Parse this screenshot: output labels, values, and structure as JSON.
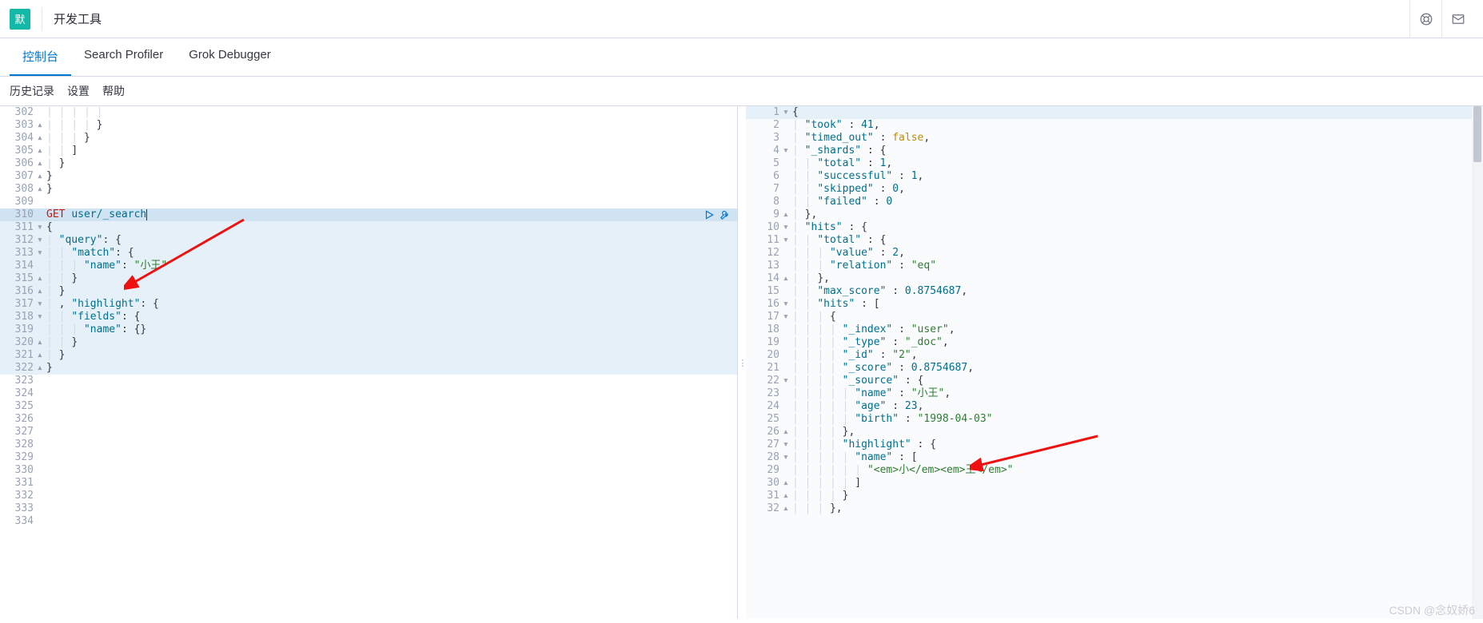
{
  "header": {
    "badge": "默",
    "title": "开发工具"
  },
  "tabs": {
    "items": [
      {
        "label": "控制台",
        "active": true
      },
      {
        "label": "Search Profiler",
        "active": false
      },
      {
        "label": "Grok Debugger",
        "active": false
      }
    ]
  },
  "subtabs": {
    "history": "历史记录",
    "settings": "设置",
    "help": "帮助"
  },
  "request": {
    "active_line": 310,
    "method": "GET",
    "path": "user/_search",
    "lines": [
      {
        "n": 302,
        "fold": "",
        "indent": 5,
        "tokens": []
      },
      {
        "n": 303,
        "fold": "▴",
        "indent": 4,
        "tokens": [
          {
            "t": "punc",
            "v": "}"
          }
        ]
      },
      {
        "n": 304,
        "fold": "▴",
        "indent": 3,
        "tokens": [
          {
            "t": "punc",
            "v": "}"
          }
        ]
      },
      {
        "n": 305,
        "fold": "▴",
        "indent": 2,
        "tokens": [
          {
            "t": "punc",
            "v": "]"
          }
        ]
      },
      {
        "n": 306,
        "fold": "▴",
        "indent": 1,
        "tokens": [
          {
            "t": "punc",
            "v": "}"
          }
        ]
      },
      {
        "n": 307,
        "fold": "▴",
        "indent": 0,
        "tokens": [
          {
            "t": "punc",
            "v": "}"
          }
        ]
      },
      {
        "n": 308,
        "fold": "▴",
        "indent": 0,
        "tokens": [
          {
            "t": "punc",
            "v": "}"
          }
        ],
        "outdent": true
      },
      {
        "n": 309,
        "fold": "",
        "indent": 0,
        "tokens": []
      },
      {
        "n": 310,
        "fold": "",
        "indent": 0,
        "active": true,
        "request_line": true
      },
      {
        "n": 311,
        "fold": "▾",
        "indent": 0,
        "hl": true,
        "tokens": [
          {
            "t": "punc",
            "v": "{"
          }
        ],
        "outdent": true
      },
      {
        "n": 312,
        "fold": "▾",
        "indent": 1,
        "hl": true,
        "tokens": [
          {
            "t": "key",
            "v": "\"query\""
          },
          {
            "t": "punc",
            "v": ": {"
          }
        ]
      },
      {
        "n": 313,
        "fold": "▾",
        "indent": 2,
        "hl": true,
        "tokens": [
          {
            "t": "key",
            "v": "\"match\""
          },
          {
            "t": "punc",
            "v": ": {"
          }
        ]
      },
      {
        "n": 314,
        "fold": "",
        "indent": 3,
        "hl": true,
        "tokens": [
          {
            "t": "key",
            "v": "\"name\""
          },
          {
            "t": "punc",
            "v": ": "
          },
          {
            "t": "str",
            "v": "\"小王\""
          }
        ]
      },
      {
        "n": 315,
        "fold": "▴",
        "indent": 2,
        "hl": true,
        "tokens": [
          {
            "t": "punc",
            "v": "}"
          }
        ]
      },
      {
        "n": 316,
        "fold": "▴",
        "indent": 1,
        "hl": true,
        "tokens": [
          {
            "t": "punc",
            "v": "}"
          }
        ]
      },
      {
        "n": 317,
        "fold": "▾",
        "indent": 1,
        "hl": true,
        "tokens": [
          {
            "t": "punc",
            "v": ", "
          },
          {
            "t": "key",
            "v": "\"highlight\""
          },
          {
            "t": "punc",
            "v": ": {"
          }
        ]
      },
      {
        "n": 318,
        "fold": "▾",
        "indent": 2,
        "hl": true,
        "tokens": [
          {
            "t": "key",
            "v": "\"fields\""
          },
          {
            "t": "punc",
            "v": ": {"
          }
        ]
      },
      {
        "n": 319,
        "fold": "",
        "indent": 3,
        "hl": true,
        "tokens": [
          {
            "t": "key",
            "v": "\"name\""
          },
          {
            "t": "punc",
            "v": ": {}"
          }
        ]
      },
      {
        "n": 320,
        "fold": "▴",
        "indent": 2,
        "hl": true,
        "tokens": [
          {
            "t": "punc",
            "v": "}"
          }
        ]
      },
      {
        "n": 321,
        "fold": "▴",
        "indent": 1,
        "hl": true,
        "tokens": [
          {
            "t": "punc",
            "v": "}"
          }
        ]
      },
      {
        "n": 322,
        "fold": "▴",
        "indent": 0,
        "hl": true,
        "tokens": [
          {
            "t": "punc",
            "v": "}"
          }
        ],
        "outdent": true
      },
      {
        "n": 323,
        "fold": "",
        "indent": 0,
        "tokens": []
      },
      {
        "n": 324,
        "fold": "",
        "indent": 0,
        "tokens": []
      },
      {
        "n": 325,
        "fold": "",
        "indent": 0,
        "tokens": []
      },
      {
        "n": 326,
        "fold": "",
        "indent": 0,
        "tokens": []
      },
      {
        "n": 327,
        "fold": "",
        "indent": 0,
        "tokens": []
      },
      {
        "n": 328,
        "fold": "",
        "indent": 0,
        "tokens": []
      },
      {
        "n": 329,
        "fold": "",
        "indent": 0,
        "tokens": []
      },
      {
        "n": 330,
        "fold": "",
        "indent": 0,
        "tokens": []
      },
      {
        "n": 331,
        "fold": "",
        "indent": 0,
        "tokens": []
      },
      {
        "n": 332,
        "fold": "",
        "indent": 0,
        "tokens": []
      },
      {
        "n": 333,
        "fold": "",
        "indent": 0,
        "tokens": []
      },
      {
        "n": 334,
        "fold": "",
        "indent": 0,
        "tokens": []
      }
    ]
  },
  "response": {
    "lines": [
      {
        "n": 1,
        "fold": "▾",
        "indent": 0,
        "first": true,
        "tokens": [
          {
            "t": "punc",
            "v": "{"
          }
        ],
        "outdent": true
      },
      {
        "n": 2,
        "fold": "",
        "indent": 1,
        "tokens": [
          {
            "t": "key",
            "v": "\"took\""
          },
          {
            "t": "punc",
            "v": " : "
          },
          {
            "t": "num",
            "v": "41"
          },
          {
            "t": "punc",
            "v": ","
          }
        ]
      },
      {
        "n": 3,
        "fold": "",
        "indent": 1,
        "tokens": [
          {
            "t": "key",
            "v": "\"timed_out\""
          },
          {
            "t": "punc",
            "v": " : "
          },
          {
            "t": "bool",
            "v": "false"
          },
          {
            "t": "punc",
            "v": ","
          }
        ]
      },
      {
        "n": 4,
        "fold": "▾",
        "indent": 1,
        "tokens": [
          {
            "t": "key",
            "v": "\"_shards\""
          },
          {
            "t": "punc",
            "v": " : {"
          }
        ]
      },
      {
        "n": 5,
        "fold": "",
        "indent": 2,
        "tokens": [
          {
            "t": "key",
            "v": "\"total\""
          },
          {
            "t": "punc",
            "v": " : "
          },
          {
            "t": "num",
            "v": "1"
          },
          {
            "t": "punc",
            "v": ","
          }
        ]
      },
      {
        "n": 6,
        "fold": "",
        "indent": 2,
        "tokens": [
          {
            "t": "key",
            "v": "\"successful\""
          },
          {
            "t": "punc",
            "v": " : "
          },
          {
            "t": "num",
            "v": "1"
          },
          {
            "t": "punc",
            "v": ","
          }
        ]
      },
      {
        "n": 7,
        "fold": "",
        "indent": 2,
        "tokens": [
          {
            "t": "key",
            "v": "\"skipped\""
          },
          {
            "t": "punc",
            "v": " : "
          },
          {
            "t": "num",
            "v": "0"
          },
          {
            "t": "punc",
            "v": ","
          }
        ]
      },
      {
        "n": 8,
        "fold": "",
        "indent": 2,
        "tokens": [
          {
            "t": "key",
            "v": "\"failed\""
          },
          {
            "t": "punc",
            "v": " : "
          },
          {
            "t": "num",
            "v": "0"
          }
        ]
      },
      {
        "n": 9,
        "fold": "▴",
        "indent": 1,
        "tokens": [
          {
            "t": "punc",
            "v": "},"
          }
        ]
      },
      {
        "n": 10,
        "fold": "▾",
        "indent": 1,
        "tokens": [
          {
            "t": "key",
            "v": "\"hits\""
          },
          {
            "t": "punc",
            "v": " : {"
          }
        ]
      },
      {
        "n": 11,
        "fold": "▾",
        "indent": 2,
        "tokens": [
          {
            "t": "key",
            "v": "\"total\""
          },
          {
            "t": "punc",
            "v": " : {"
          }
        ]
      },
      {
        "n": 12,
        "fold": "",
        "indent": 3,
        "tokens": [
          {
            "t": "key",
            "v": "\"value\""
          },
          {
            "t": "punc",
            "v": " : "
          },
          {
            "t": "num",
            "v": "2"
          },
          {
            "t": "punc",
            "v": ","
          }
        ]
      },
      {
        "n": 13,
        "fold": "",
        "indent": 3,
        "tokens": [
          {
            "t": "key",
            "v": "\"relation\""
          },
          {
            "t": "punc",
            "v": " : "
          },
          {
            "t": "str",
            "v": "\"eq\""
          }
        ]
      },
      {
        "n": 14,
        "fold": "▴",
        "indent": 2,
        "tokens": [
          {
            "t": "punc",
            "v": "},"
          }
        ]
      },
      {
        "n": 15,
        "fold": "",
        "indent": 2,
        "tokens": [
          {
            "t": "key",
            "v": "\"max_score\""
          },
          {
            "t": "punc",
            "v": " : "
          },
          {
            "t": "num",
            "v": "0.8754687"
          },
          {
            "t": "punc",
            "v": ","
          }
        ]
      },
      {
        "n": 16,
        "fold": "▾",
        "indent": 2,
        "tokens": [
          {
            "t": "key",
            "v": "\"hits\""
          },
          {
            "t": "punc",
            "v": " : ["
          }
        ]
      },
      {
        "n": 17,
        "fold": "▾",
        "indent": 3,
        "tokens": [
          {
            "t": "punc",
            "v": "{"
          }
        ]
      },
      {
        "n": 18,
        "fold": "",
        "indent": 4,
        "tokens": [
          {
            "t": "key",
            "v": "\"_index\""
          },
          {
            "t": "punc",
            "v": " : "
          },
          {
            "t": "str",
            "v": "\"user\""
          },
          {
            "t": "punc",
            "v": ","
          }
        ]
      },
      {
        "n": 19,
        "fold": "",
        "indent": 4,
        "tokens": [
          {
            "t": "key",
            "v": "\"_type\""
          },
          {
            "t": "punc",
            "v": " : "
          },
          {
            "t": "str",
            "v": "\"_doc\""
          },
          {
            "t": "punc",
            "v": ","
          }
        ]
      },
      {
        "n": 20,
        "fold": "",
        "indent": 4,
        "tokens": [
          {
            "t": "key",
            "v": "\"_id\""
          },
          {
            "t": "punc",
            "v": " : "
          },
          {
            "t": "str",
            "v": "\"2\""
          },
          {
            "t": "punc",
            "v": ","
          }
        ]
      },
      {
        "n": 21,
        "fold": "",
        "indent": 4,
        "tokens": [
          {
            "t": "key",
            "v": "\"_score\""
          },
          {
            "t": "punc",
            "v": " : "
          },
          {
            "t": "num",
            "v": "0.8754687"
          },
          {
            "t": "punc",
            "v": ","
          }
        ]
      },
      {
        "n": 22,
        "fold": "▾",
        "indent": 4,
        "tokens": [
          {
            "t": "key",
            "v": "\"_source\""
          },
          {
            "t": "punc",
            "v": " : {"
          }
        ]
      },
      {
        "n": 23,
        "fold": "",
        "indent": 5,
        "tokens": [
          {
            "t": "key",
            "v": "\"name\""
          },
          {
            "t": "punc",
            "v": " : "
          },
          {
            "t": "str",
            "v": "\"小王\""
          },
          {
            "t": "punc",
            "v": ","
          }
        ]
      },
      {
        "n": 24,
        "fold": "",
        "indent": 5,
        "tokens": [
          {
            "t": "key",
            "v": "\"age\""
          },
          {
            "t": "punc",
            "v": " : "
          },
          {
            "t": "num",
            "v": "23"
          },
          {
            "t": "punc",
            "v": ","
          }
        ]
      },
      {
        "n": 25,
        "fold": "",
        "indent": 5,
        "tokens": [
          {
            "t": "key",
            "v": "\"birth\""
          },
          {
            "t": "punc",
            "v": " : "
          },
          {
            "t": "str",
            "v": "\"1998-04-03\""
          }
        ]
      },
      {
        "n": 26,
        "fold": "▴",
        "indent": 4,
        "tokens": [
          {
            "t": "punc",
            "v": "},"
          }
        ]
      },
      {
        "n": 27,
        "fold": "▾",
        "indent": 4,
        "tokens": [
          {
            "t": "key",
            "v": "\"highlight\""
          },
          {
            "t": "punc",
            "v": " : {"
          }
        ]
      },
      {
        "n": 28,
        "fold": "▾",
        "indent": 5,
        "tokens": [
          {
            "t": "key",
            "v": "\"name\""
          },
          {
            "t": "punc",
            "v": " : ["
          }
        ]
      },
      {
        "n": 29,
        "fold": "",
        "indent": 6,
        "tokens": [
          {
            "t": "str",
            "v": "\"<em>小</em><em>王</em>\""
          }
        ]
      },
      {
        "n": 30,
        "fold": "▴",
        "indent": 5,
        "tokens": [
          {
            "t": "punc",
            "v": "]"
          }
        ]
      },
      {
        "n": 31,
        "fold": "▴",
        "indent": 4,
        "tokens": [
          {
            "t": "punc",
            "v": "}"
          }
        ]
      },
      {
        "n": 32,
        "fold": "▴",
        "indent": 3,
        "tokens": [
          {
            "t": "punc",
            "v": "},"
          }
        ]
      }
    ]
  },
  "watermark": "CSDN @念奴娇6"
}
